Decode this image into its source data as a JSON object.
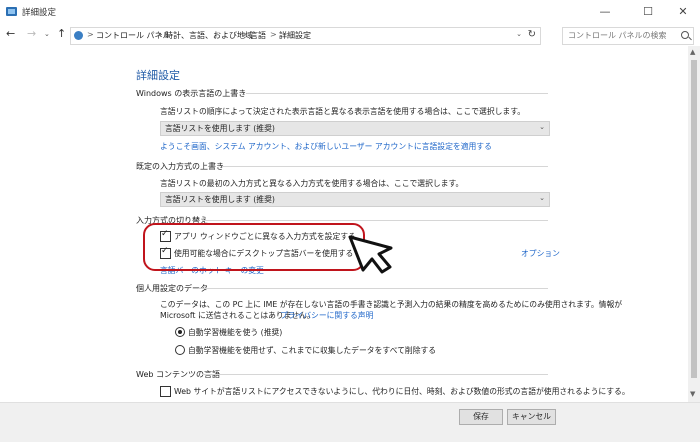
{
  "window": {
    "title": "詳細設定",
    "minimize_glyph": "—",
    "maximize_glyph": "☐",
    "close_glyph": "✕"
  },
  "navbar": {
    "back_glyph": "←",
    "forward_glyph": "→",
    "recent_glyph": "⌄",
    "up_glyph": "↑",
    "breadcrumb": [
      "コントロール パネル",
      "時計、言語、および地域",
      "言語",
      "詳細設定"
    ],
    "separator": ">",
    "address_dropdown_glyph": "⌄",
    "refresh_glyph": "↻",
    "search_placeholder": "コントロール パネルの検索"
  },
  "page": {
    "title": "詳細設定",
    "display_language_override": {
      "heading": "Windows の表示言語の上書き",
      "description": "言語リストの順序によって決定された表示言語と異なる表示言語を使用する場合は、ここで選択します。",
      "selected": "言語リストを使用します (推奨)",
      "link": "ようこそ画面、システム アカウント、および新しいユーザー アカウントに言語設定を適用する"
    },
    "input_method_override": {
      "heading": "既定の入力方式の上書き",
      "description": "言語リストの最初の入力方式と異なる入力方式を使用する場合は、ここで選択します。",
      "selected": "言語リストを使用します (推奨)"
    },
    "switching_input_methods": {
      "heading": "入力方式の切り替え",
      "per_app_checkbox": "アプリ ウィンドウごとに異なる入力方式を設定する",
      "per_app_checked": true,
      "desktop_langbar_checkbox": "使用可能な場合にデスクトップ言語バーを使用する",
      "desktop_langbar_checked": true,
      "options_link": "オプション",
      "hotkey_link": "言語バーのホット キーの変更"
    },
    "personalization_data": {
      "heading": "個人用設定のデータ",
      "description_line1": "このデータは、この PC 上に IME が存在しない言語の手書き認識と予測入力の結果の精度を高めるためにのみ使用されます。情報が",
      "description_line2": "Microsoft に送信されることはありません。",
      "privacy_link": "プライバシーに関する声明",
      "radio_use": "自動学習機能を使う (推奨)",
      "radio_use_selected": true,
      "radio_dont_use": "自動学習機能を使用せず、これまでに収集したデータをすべて削除する",
      "radio_dont_use_selected": false
    },
    "web_content_language": {
      "heading": "Web コンテンツの言語",
      "checkbox": "Web サイトが言語リストにアクセスできないようにし、代わりに日付、時刻、および数値の形式の言語が使用されるようにする。",
      "checked": false
    }
  },
  "scrollbar": {
    "up_glyph": "▲",
    "down_glyph": "▼"
  },
  "footer": {
    "save_label": "保存",
    "cancel_label": "キャンセル"
  },
  "colors": {
    "highlight": "#c0141c",
    "link": "#1e66c9",
    "title": "#1f5aa6"
  },
  "check_glyph": "✓",
  "select_arrow_glyph": "⌄"
}
